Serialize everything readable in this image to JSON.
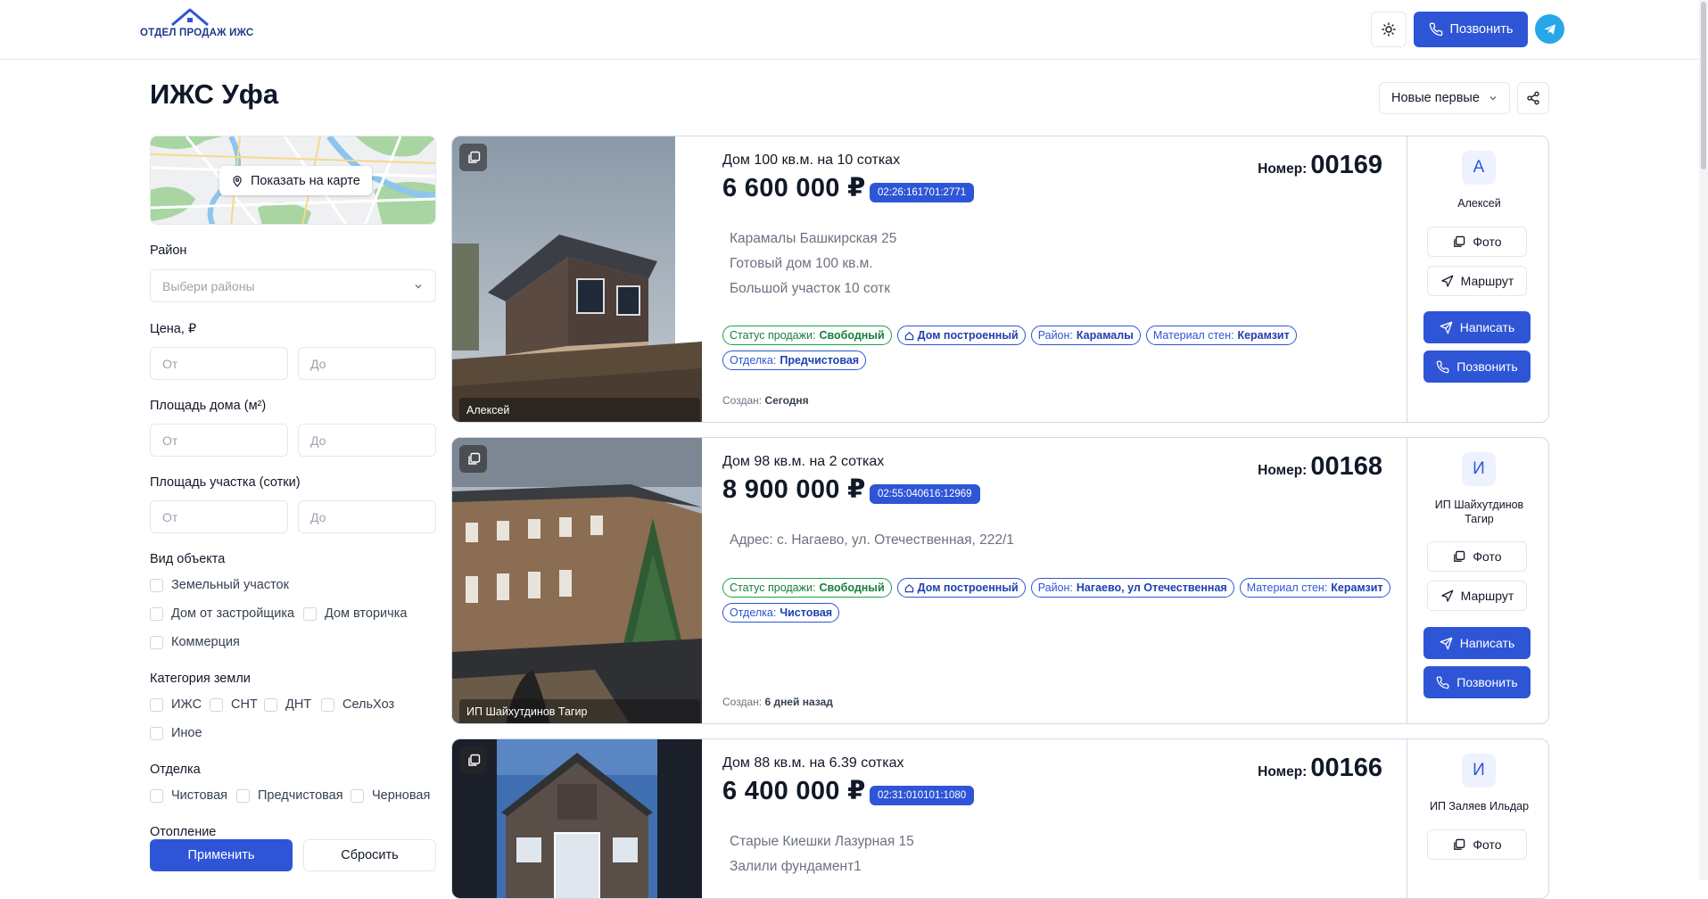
{
  "header": {
    "logo_text": "ОТДЕЛ ПРОДАЖ ИЖС",
    "call_label": "Позвонить"
  },
  "page": {
    "title": "ИЖС Уфа",
    "sort_value": "Новые первые"
  },
  "filters": {
    "map_button": "Показать на карте",
    "district_label": "Район",
    "district_placeholder": "Выбери районы",
    "price_label": "Цена, ₽",
    "house_area_label": "Площадь дома (м²)",
    "plot_area_label": "Площадь участка (сотки)",
    "from_placeholder": "От",
    "to_placeholder": "До",
    "object_type_label": "Вид объекта",
    "object_types": [
      "Земельный участок",
      "Дом от застройщика",
      "Дом вторичка",
      "Коммерция"
    ],
    "land_category_label": "Категория земли",
    "land_categories": [
      "ИЖС",
      "СНТ",
      "ДНТ",
      "СельХоз",
      "Иное"
    ],
    "finish_label": "Отделка",
    "finishes": [
      "Чистовая",
      "Предчистовая",
      "Черновая"
    ],
    "heating_label": "Отопление",
    "apply_label": "Применить",
    "reset_label": "Сбросить"
  },
  "listings": [
    {
      "agent": "Алексей",
      "avatar_letter": "А",
      "title": "Дом 100 кв.м. на 10 сотках",
      "price": "6 600 000 ₽",
      "cadastral": "02:26:161701:2771",
      "number_label": "Номер:",
      "number": "00169",
      "desc": [
        "Карамалы Башкирская 25",
        "Готовый дом 100 кв.м.",
        "Большой участок 10 сотк"
      ],
      "tags": {
        "status_k": "Статус продажи:",
        "status_v": "Свободный",
        "type_v": "Дом построенный",
        "district_k": "Район:",
        "district_v": "Карамалы",
        "walls_k": "Материал стен:",
        "walls_v": "Керамзит",
        "finish_k": "Отделка:",
        "finish_v": "Предчистовая"
      },
      "created_k": "Создан:",
      "created_v": "Сегодня",
      "photo_label": "Фото",
      "route_label": "Маршрут",
      "write_label": "Написать",
      "call_label": "Позвонить"
    },
    {
      "agent": "ИП Шайхутдинов Тагир",
      "avatar_letter": "И",
      "agent_lines": [
        "ИП Шайхутдинов",
        "Тагир"
      ],
      "title": "Дом 98 кв.м. на 2 сотках",
      "price": "8 900 000 ₽",
      "cadastral": "02:55:040616:12969",
      "number_label": "Номер:",
      "number": "00168",
      "desc": [
        "Адрес: с. Нагаево, ул. Отечественная, 222/1"
      ],
      "tags": {
        "status_k": "Статус продажи:",
        "status_v": "Свободный",
        "type_v": "Дом построенный",
        "district_k": "Район:",
        "district_v": "Нагаево, ул Отечественная",
        "walls_k": "Материал стен:",
        "walls_v": "Керамзит",
        "finish_k": "Отделка:",
        "finish_v": "Чистовая"
      },
      "created_k": "Создан:",
      "created_v": "6 дней назад",
      "photo_label": "Фото",
      "route_label": "Маршрут",
      "write_label": "Написать",
      "call_label": "Позвонить"
    },
    {
      "agent": "ИП Заляев Ильдар",
      "avatar_letter": "И",
      "title": "Дом 88 кв.м. на 6.39 сотках",
      "price": "6 400 000 ₽",
      "cadastral": "02:31:010101:1080",
      "number_label": "Номер:",
      "number": "00166",
      "desc": [
        "Старые Киешки Лазурная 15",
        "Залили фундамент1"
      ],
      "photo_label": "Фото"
    }
  ]
}
